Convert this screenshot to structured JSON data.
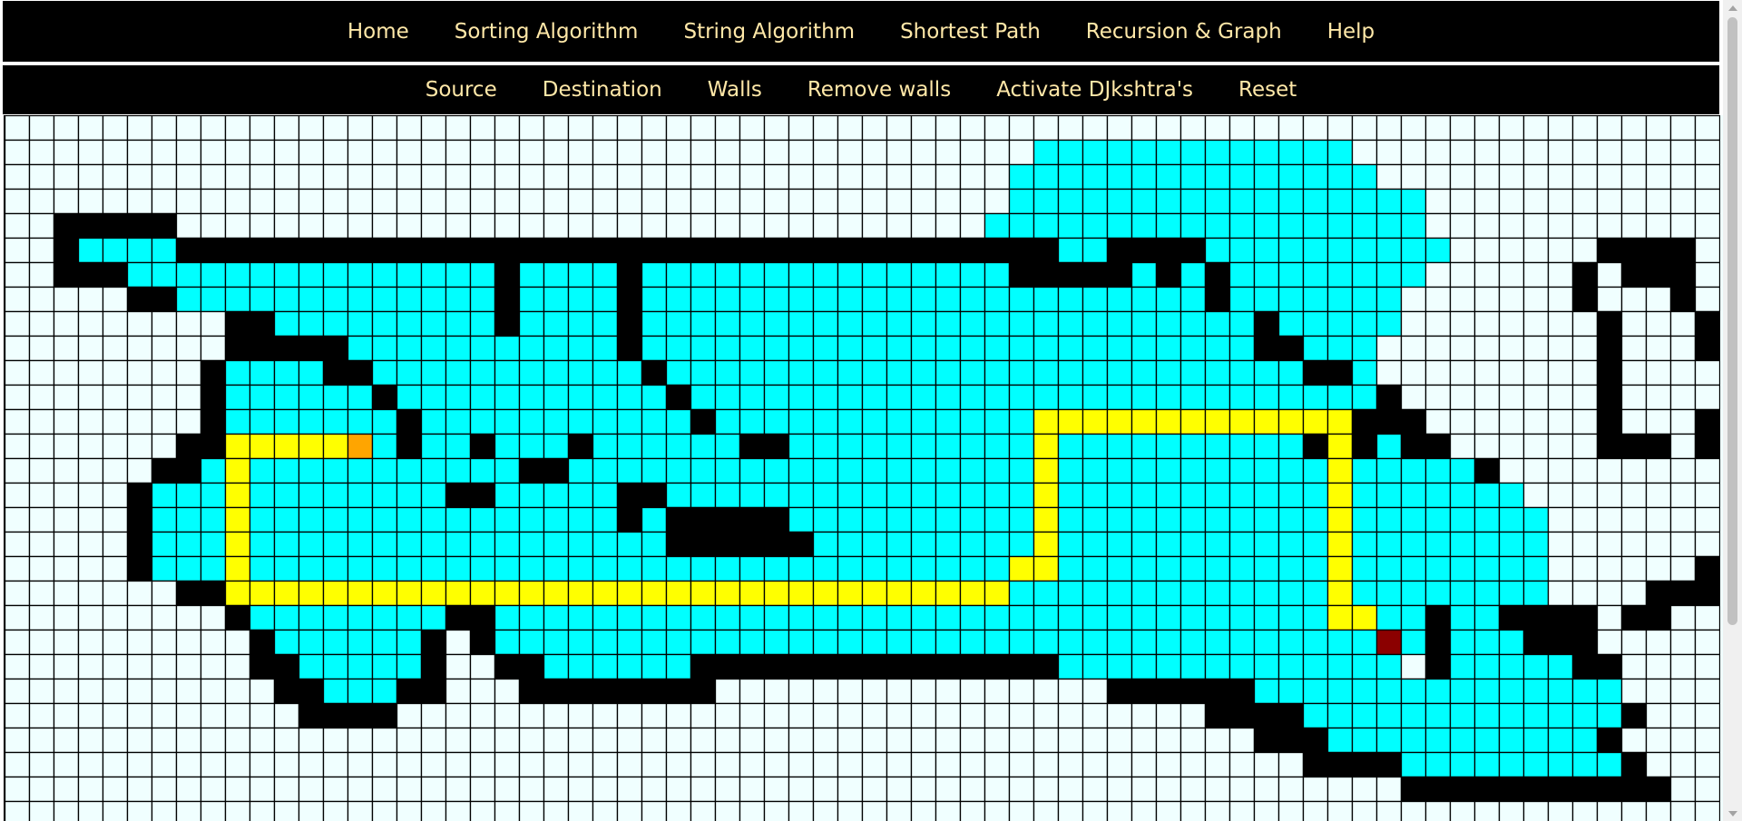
{
  "main_nav": {
    "items": [
      "Home",
      "Sorting Algorithm",
      "String Algorithm",
      "Shortest Path",
      "Recursion & Graph",
      "Help"
    ]
  },
  "tool_nav": {
    "items": [
      "Source",
      "Destination",
      "Walls",
      "Remove walls",
      "Activate DJkshtra's",
      "Reset"
    ]
  },
  "grid": {
    "columns": 70,
    "rows": 29,
    "colors": {
      "empty": "#f0ffff",
      "wall": "#000000",
      "visited": "#00ffff",
      "path": "#ffff00",
      "source": "#ffa500",
      "destination": "#8b0000",
      "line": "#000000"
    },
    "cells": [
      "......................................................................",
      "..........................................VVVVVVVVVVVVV...............",
      ".........................................VVVVVVVVVVVVVVV..............",
      ".........................................VVVVVVVVVVVVVVVVV.............",
      "..WWWWW.................................VVVVVVVVVVVVVVVVVV............",
      "..WVVVVWWWWWWWWWWWWWWWWWWWWWWWWWWWWWWWWWWWWVVWWWWVVVVVVVVVV......WWWW..",
      "..WWWVVVVVVVVVVVVVVVWVVVVWVVVVVVVVVVVVVVVWWWWWVWVWVVVVVVVV......W.WWW..",
      ".....WWVVVVVVVVVVVVVWVVVVWVVVVVVVVVVVVVVVVVVVVVVVWVVVVVVV.......W...W..",
      ".........WWVVVVVVVVVWVVVVWVVVVVVVVVVVVVVVVVVVVVVVVVWVVVVV........W...W..",
      ".........WWWWWVVVVVVVVVVVWVVVVVVVVVVVVVVVVVVVVVVVVVWWVVV.........W...WW.",
      "........WVVVVWWVVVVVVVVVVVWVVVVVVVVVVVVVVVVVVVVVVVVVVWWV.........W......",
      "........WVVVVVVWVVVVVVVVVVVWVVVVVVVVVVVVVVVVVVVVVVVVVVVVW........W......",
      "........WVVVVVVVWVVVVVVVVVVVWVVVVVVVVVVVVVYYYYYYYYYYYYYWWW.......W...W..",
      ".......WWYYYYYVVWVVWVVVWVVVVVVWWVVVVVVVVVVYVVVVVVVVVVWYWVWW......WWW.W..",
      "......WWVYVVVVVVVVVVVWWVVVVVVVVVVVVVVVVVVVYVVVVVVVVVVVYVVVVVW.........W.",
      ".....WVVVYVVVVVVVVWWVVVVVWWVVVVVVVVVVVVVVVYVVVVVVVVVVVYVVVVVVV........W.",
      ".....WVVVYVVVVVVVVVVVVVVVWVWWWWWVVVVVVVVVVYVVVVVVVVVVVYVVVVVVVV.......W.",
      ".....WVVVYVVVVVVVVVVVVVVVVVWWWWWWVVVVVVVVVYVVVVVVVVVVVYVVVVVVVV.......W.",
      ".....WVVVYVVVVVVVVVVVVVVVVVVVVVVVVVVVVVVVYYVVVVVVVVVVVYVVVVVVVV......WW.",
      ".......WWYYYYYYYYYYYYYYYYYYYYYYYYYYYYYYYYVVVVVVVVVVVVVYVVVVVVVV....WWW..",
      ".........WVVVVVVVVWWVVVVVVVVVVVVVVVVVVVVVVVVVVVVVVVVVVYYVVWVVWWWW.WW...",
      "..........WVVVVVVW.WVVVVVVVVVVVVVVVVVVVVVVVVVVVVVVVVVVVVDVWVVVWWW......",
      "..........WWVVVVVW..WWVVVVVVWWWWWWWWWWWWWWWVVVVVVVVVVVVVV.WVVVVVWW.....",
      "...........WWVVVWW...WWWWWWWW................WWWWWWVVVVVVVVVVVVVVV.....",
      "............WWWW.................................WWWWVVVVVVVVVVVVVW.....",
      "...................................................WWWVVVVVVVVVVVW.....",
      ".....................................................WWWWVVVVVVVVVW.....",
      ".........................................................WWWWWWWWWWW....",
      "......................................................................"
    ]
  }
}
